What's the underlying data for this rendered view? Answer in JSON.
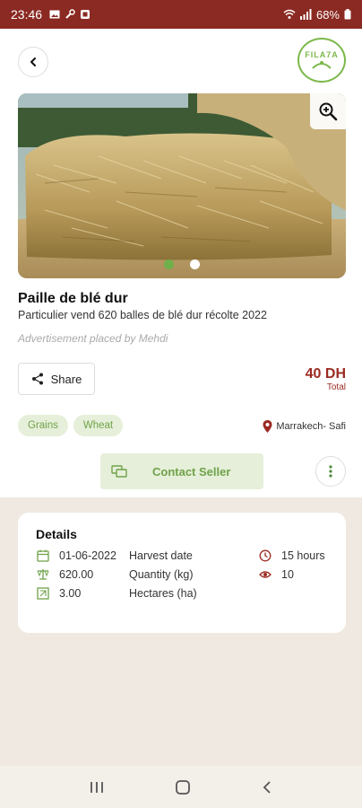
{
  "status_bar": {
    "time": "23:46",
    "battery": "68%",
    "icons": [
      "image-icon",
      "tool-icon",
      "app-icon",
      "wifi-icon",
      "signal-icon",
      "battery-icon"
    ]
  },
  "header": {
    "back_icon": "chevron-left-icon",
    "logo_text": "FILA7A"
  },
  "gallery": {
    "image_subject": "straw bale photo",
    "image_count": 2,
    "active_index": 0,
    "zoom_icon": "zoom-in-icon"
  },
  "listing": {
    "title": "Paille de blé dur",
    "subtitle": "Particulier vend 620 balles de blé dur récolte 2022",
    "placed_by": "Advertisement placed by Mehdi",
    "share_label": "Share",
    "price": "40 DH",
    "price_label": "Total",
    "tags": [
      "Grains",
      "Wheat"
    ],
    "location": "Marrakech- Safi",
    "contact_label": "Contact Seller"
  },
  "details": {
    "title": "Details",
    "rows": [
      {
        "icon": "calendar-icon",
        "value": "01-06-2022",
        "label": "Harvest date"
      },
      {
        "icon": "scale-icon",
        "value": "620.00",
        "label": "Quantity (kg)"
      },
      {
        "icon": "area-icon",
        "value": "3.00",
        "label": "Hectares (ha)"
      }
    ],
    "side": [
      {
        "icon": "clock-icon",
        "value": "15 hours"
      },
      {
        "icon": "eye-icon",
        "value": "10"
      }
    ]
  },
  "colors": {
    "status_bar": "#8a2a22",
    "accent_green": "#6fb04a",
    "price_red": "#9b2a22",
    "background": "#efe9e2"
  }
}
